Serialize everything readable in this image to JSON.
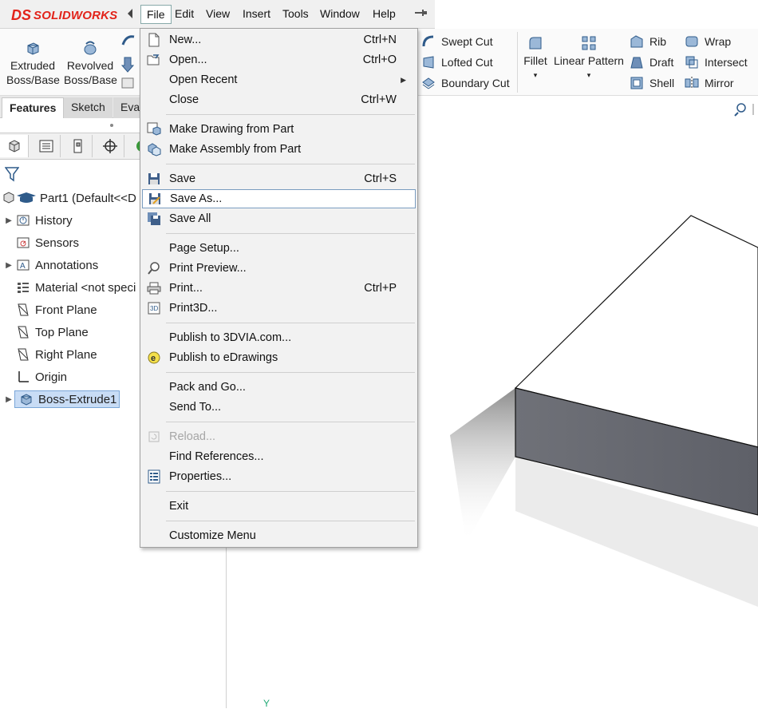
{
  "app": {
    "logo_ds": "DS",
    "logo_text": "SOLIDWORKS"
  },
  "menubar": {
    "items": [
      "File",
      "Edit",
      "View",
      "Insert",
      "Tools",
      "Window",
      "Help"
    ]
  },
  "command_manager": {
    "extruded": "Extruded\nBoss/Base",
    "extruded_l1": "Extruded",
    "extruded_l2": "Boss/Base",
    "revolved_l1": "Revolved",
    "revolved_l2": "Boss/Base",
    "swept_cut": "Swept Cut",
    "lofted_cut": "Lofted Cut",
    "boundary_cut": "Boundary Cut",
    "fillet": "Fillet",
    "linear_pattern": "Linear Pattern",
    "rib": "Rib",
    "draft": "Draft",
    "shell": "Shell",
    "wrap": "Wrap",
    "intersect": "Intersect",
    "mirror": "Mirror"
  },
  "tabs": {
    "features": "Features",
    "sketch": "Sketch",
    "evaluate": "Eva"
  },
  "tree": {
    "part": "Part1  (Default<<D",
    "items": [
      "History",
      "Sensors",
      "Annotations",
      "Material <not speci",
      "Front Plane",
      "Top Plane",
      "Right Plane",
      "Origin",
      "Boss-Extrude1"
    ]
  },
  "file_menu": {
    "new": "New...",
    "new_sc": "Ctrl+N",
    "open": "Open...",
    "open_sc": "Ctrl+O",
    "open_recent": "Open Recent",
    "close": "Close",
    "close_sc": "Ctrl+W",
    "make_drawing": "Make Drawing from Part",
    "make_assembly": "Make Assembly from Part",
    "save": "Save",
    "save_sc": "Ctrl+S",
    "save_as": "Save As...",
    "save_all": "Save All",
    "page_setup": "Page Setup...",
    "print_preview": "Print Preview...",
    "print": "Print...",
    "print_sc": "Ctrl+P",
    "print3d": "Print3D...",
    "publish_3dvia": "Publish to 3DVIA.com...",
    "publish_edrawings": "Publish to eDrawings",
    "pack_and_go": "Pack and Go...",
    "send_to": "Send To...",
    "reload": "Reload...",
    "find_references": "Find References...",
    "properties": "Properties...",
    "exit": "Exit",
    "customize_menu": "Customize Menu"
  },
  "viewport": {
    "triad_y": "Y"
  },
  "colors": {
    "brand_red": "#e2231a",
    "highlight": "#c8dcf5",
    "menu_bg": "#f2f2f2"
  }
}
